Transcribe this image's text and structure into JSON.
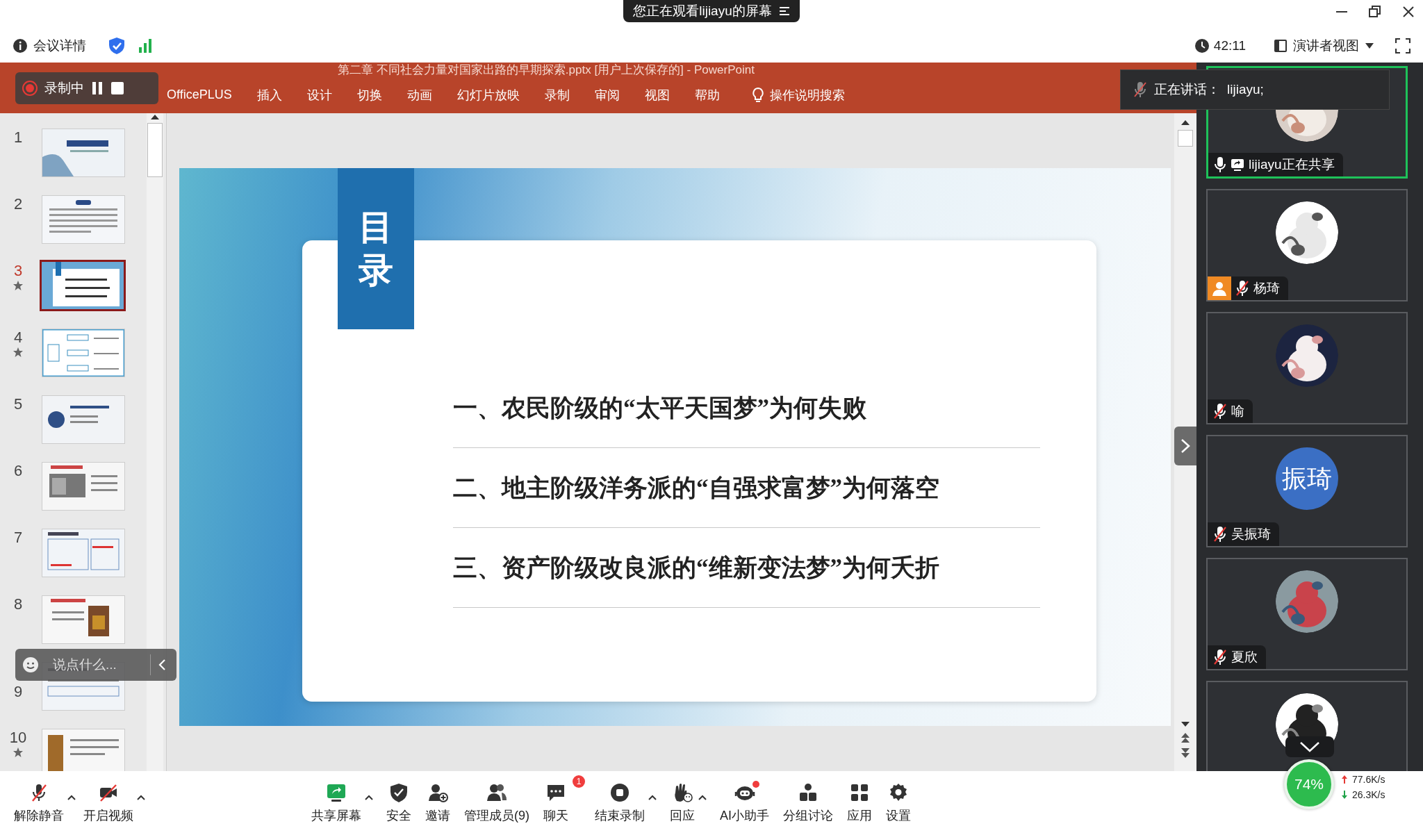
{
  "banner": {
    "text": "您正在观看lijiayu的屏幕"
  },
  "meeting_bar": {
    "details": "会议详情",
    "timer": "42:11",
    "view_mode": "演讲者视图"
  },
  "powerpoint": {
    "title": "第二章 不同社会力量对国家出路的早期探索.pptx [用户上次保存的] - PowerPoint",
    "tabs": [
      "OfficePLUS",
      "插入",
      "设计",
      "切换",
      "动画",
      "幻灯片放映",
      "录制",
      "审阅",
      "视图",
      "帮助"
    ],
    "search_hint": "操作说明搜索",
    "slides": [
      {
        "number": "1",
        "selected": false,
        "starred": false
      },
      {
        "number": "2",
        "selected": false,
        "starred": false
      },
      {
        "number": "3",
        "selected": true,
        "starred": true
      },
      {
        "number": "4",
        "selected": false,
        "starred": true
      },
      {
        "number": "5",
        "selected": false,
        "starred": false
      },
      {
        "number": "6",
        "selected": false,
        "starred": false
      },
      {
        "number": "7",
        "selected": false,
        "starred": false
      },
      {
        "number": "8",
        "selected": false,
        "starred": false
      },
      {
        "number": "9",
        "selected": false,
        "starred": false
      },
      {
        "number": "10",
        "selected": false,
        "starred": true
      }
    ],
    "slide": {
      "heading": "目录",
      "items": [
        "一、农民阶级的“太平天国梦”为何失败",
        "二、地主阶级洋务派的“自强求富梦”为何落空",
        "三、资产阶级改良派的“维新变法梦”为何夭折"
      ]
    }
  },
  "recording": {
    "label": "录制中"
  },
  "speaking": {
    "label": "正在讲话：",
    "names": "lijiayu;"
  },
  "chat": {
    "placeholder": "说点什么..."
  },
  "participants": [
    {
      "name": "lijiayu正在共享",
      "active": true,
      "mic_on": true,
      "sharing": true,
      "host": false
    },
    {
      "name": "杨琦",
      "active": false,
      "mic_on": false,
      "sharing": false,
      "host": true
    },
    {
      "name": "喻",
      "active": false,
      "mic_on": false,
      "sharing": false,
      "host": false
    },
    {
      "name": "吴振琦",
      "active": false,
      "mic_on": false,
      "sharing": false,
      "host": false,
      "avatar": {
        "kind": "initials",
        "text": "振琦"
      }
    },
    {
      "name": "夏欣",
      "active": false,
      "mic_on": false,
      "sharing": false,
      "host": false
    },
    {
      "active": false
    }
  ],
  "toolbar": [
    {
      "label": "解除静音",
      "kind": "mic-off",
      "menu": true
    },
    {
      "label": "开启视频",
      "kind": "camera-off",
      "menu": true
    },
    {
      "label": "共享屏幕",
      "kind": "share",
      "menu": true
    },
    {
      "label": "安全",
      "kind": "shield",
      "menu": false
    },
    {
      "label": "邀请",
      "kind": "invite",
      "menu": false
    },
    {
      "label": "管理成员(9)",
      "kind": "members",
      "menu": false
    },
    {
      "label": "聊天",
      "kind": "chat",
      "menu": false,
      "badge": "1"
    },
    {
      "label": "结束录制",
      "kind": "stop",
      "menu": true
    },
    {
      "label": "回应",
      "kind": "hand",
      "menu": true
    },
    {
      "label": "AI小助手",
      "kind": "robot",
      "menu": false,
      "dot": true
    },
    {
      "label": "分组讨论",
      "kind": "groups",
      "menu": false
    },
    {
      "label": "应用",
      "kind": "apps",
      "menu": false
    },
    {
      "label": "设置",
      "kind": "settings",
      "menu": false
    }
  ],
  "network": {
    "cpu": "74%",
    "upload": "77.6K/s",
    "download": "26.3K/s"
  }
}
